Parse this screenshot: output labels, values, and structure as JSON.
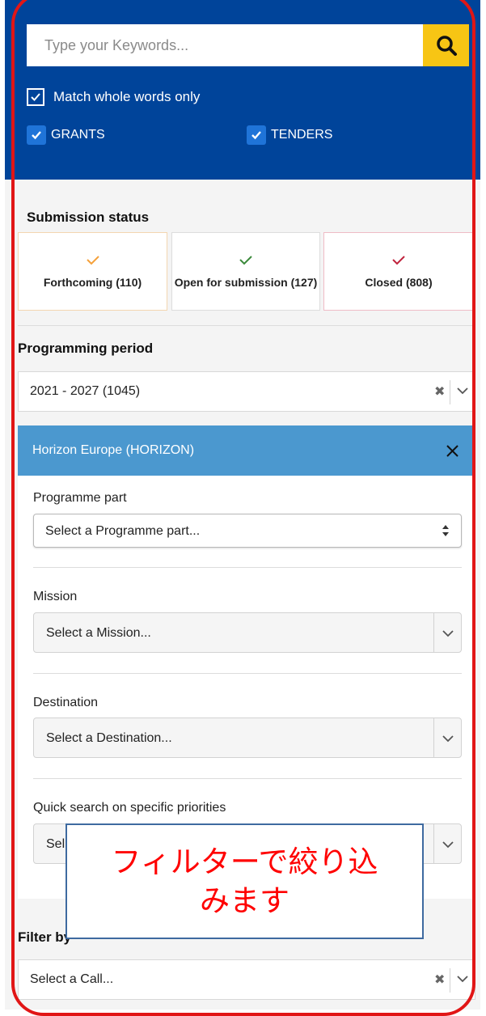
{
  "search": {
    "placeholder": "Type your Keywords..."
  },
  "options": {
    "match_whole_words": "Match whole words only",
    "grants": "GRANTS",
    "tenders": "TENDERS"
  },
  "submission_status": {
    "title": "Submission status",
    "items": [
      {
        "label": "Forthcoming (110)",
        "color": "#f5a13b"
      },
      {
        "label": "Open for submission (127)",
        "color": "#3c8a3c"
      },
      {
        "label": "Closed (808)",
        "color": "#c0233d"
      }
    ]
  },
  "programming_period": {
    "title": "Programming period",
    "value": "2021 - 2027 (1045)"
  },
  "programme": {
    "name": "Horizon Europe (HORIZON)",
    "programme_part": {
      "label": "Programme part",
      "placeholder": "Select a Programme part..."
    },
    "mission": {
      "label": "Mission",
      "placeholder": "Select a Mission..."
    },
    "destination": {
      "label": "Destination",
      "placeholder": "Select a Destination..."
    },
    "quick_search": {
      "label": "Quick search on specific priorities",
      "visible_text": "Sel"
    }
  },
  "filter_by": {
    "title": "Filter by",
    "placeholder": "Select a Call..."
  },
  "overlay": {
    "line1": "フィルターで絞り込",
    "line2": "みます"
  },
  "colors": {
    "header_blue": "#00449a",
    "search_yellow": "#f7c514",
    "programme_blue": "#4b98cf",
    "annotation_red": "#e11616"
  }
}
